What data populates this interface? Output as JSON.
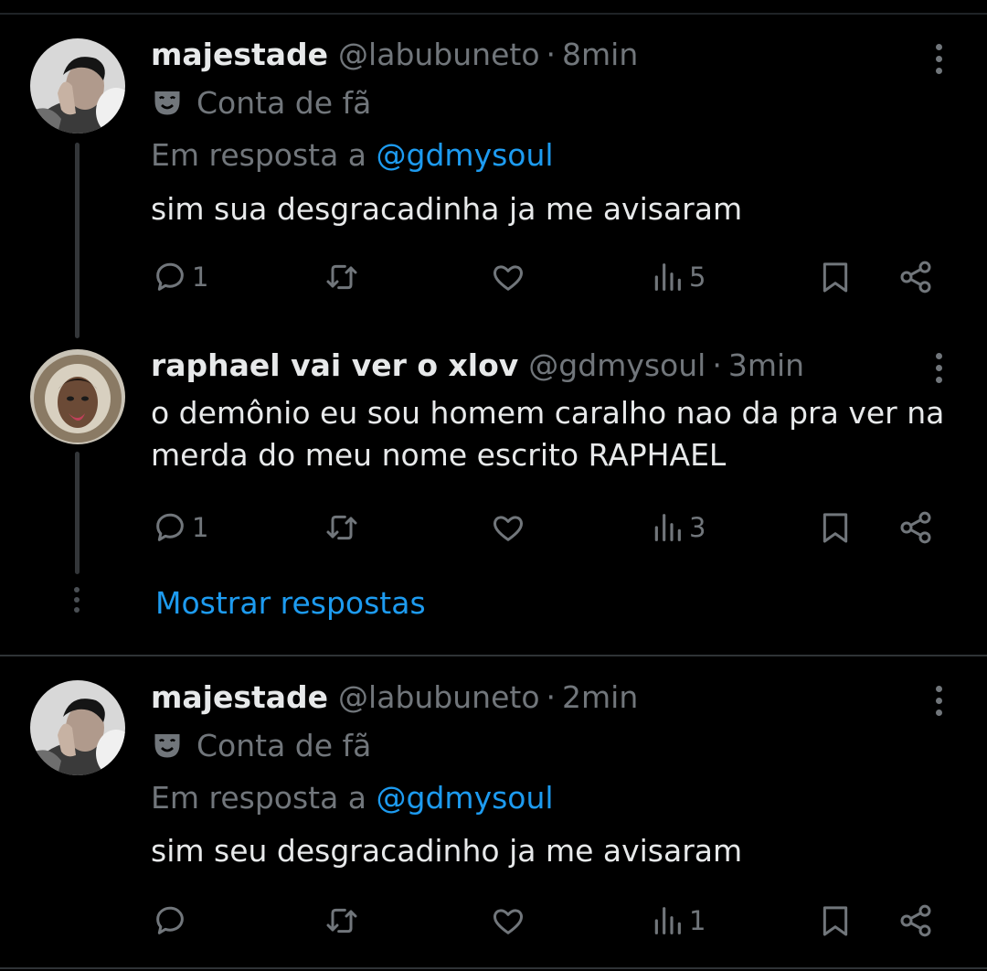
{
  "tweets": [
    {
      "display_name": "majestade",
      "handle": "@labubuneto",
      "separator": "·",
      "time": "8min",
      "fan_label": "Conta de fã",
      "reply_prefix": "Em resposta a",
      "reply_mention": "@gdmysoul",
      "text": "sim sua desgracadinha ja me avisaram",
      "replies": "1",
      "views": "5"
    },
    {
      "display_name": "raphael vai ver o xlov",
      "handle": "@gdmysoul",
      "separator": "·",
      "time": "3min",
      "text": "o demônio eu sou homem caralho nao da pra ver na merda do meu nome escrito RAPHAEL",
      "replies": "1",
      "views": "3"
    },
    {
      "display_name": "majestade",
      "handle": "@labubuneto",
      "separator": "·",
      "time": "2min",
      "fan_label": "Conta de fã",
      "reply_prefix": "Em resposta a",
      "reply_mention": "@gdmysoul",
      "text": "sim seu desgracadinho ja me avisaram",
      "replies": "",
      "views": "1"
    }
  ],
  "show_replies_label": "Mostrar respostas",
  "icons": {
    "reply": "reply-icon",
    "repost": "repost-icon",
    "like": "like-icon",
    "views": "views-icon",
    "bookmark": "bookmark-icon",
    "share": "share-icon",
    "more": "more-icon",
    "fan": "theater-mask-icon"
  },
  "colors": {
    "background": "#000000",
    "text": "#e7e9ea",
    "muted": "#71767b",
    "link": "#1d9bf0",
    "divider": "#2f3336"
  }
}
